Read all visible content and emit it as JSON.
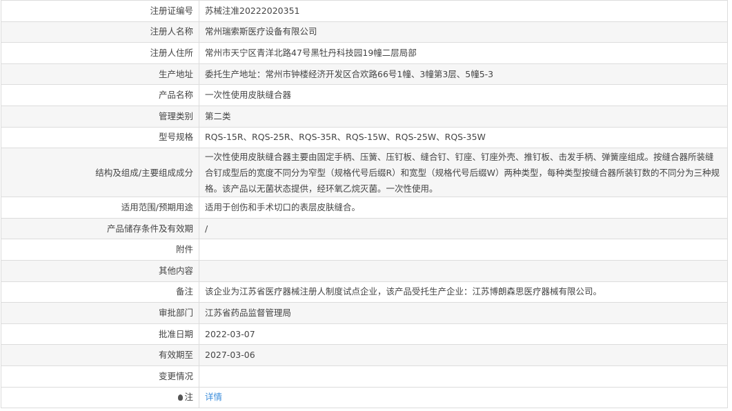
{
  "rows": [
    {
      "label": "注册证编号",
      "value": "苏械注准20222020351"
    },
    {
      "label": "注册人名称",
      "value": "常州瑞索斯医疗设备有限公司"
    },
    {
      "label": "注册人住所",
      "value": "常州市天宁区青洋北路47号黑牡丹科技园19幢二层局部"
    },
    {
      "label": "生产地址",
      "value": "委托生产地址：常州市钟楼经济开发区合欢路66号1幢、3幢第3层、5幢5-3"
    },
    {
      "label": "产品名称",
      "value": "一次性使用皮肤缝合器"
    },
    {
      "label": "管理类别",
      "value": "第二类"
    },
    {
      "label": "型号规格",
      "value": "RQS-15R、RQS-25R、RQS-35R、RQS-15W、RQS-25W、RQS-35W"
    },
    {
      "label": "结构及组成/主要组成成分",
      "value": "一次性使用皮肤缝合器主要由固定手柄、压簧、压钉板、缝合钉、钉座、钉座外壳、推钉板、击发手柄、弹簧座组成。按缝合器所装缝合钉成型后的宽度不同分为窄型（规格代号后缀R）和宽型（规格代号后缀W）两种类型，每种类型按缝合器所装钉数的不同分为三种规格。该产品以无菌状态提供，经环氧乙烷灭菌。一次性使用。"
    },
    {
      "label": "适用范围/预期用途",
      "value": "适用于创伤和手术切口的表层皮肤缝合。"
    },
    {
      "label": "产品储存条件及有效期",
      "value": "/"
    },
    {
      "label": "附件",
      "value": ""
    },
    {
      "label": "其他内容",
      "value": ""
    },
    {
      "label": "备注",
      "value": "该企业为江苏省医疗器械注册人制度试点企业，该产品受托生产企业：江苏博朗森思医疗器械有限公司。"
    },
    {
      "label": "审批部门",
      "value": "江苏省药品监督管理局"
    },
    {
      "label": "批准日期",
      "value": "2022-03-07"
    },
    {
      "label": "有效期至",
      "value": "2027-03-06"
    },
    {
      "label": "变更情况",
      "value": ""
    }
  ],
  "note": {
    "label": "注",
    "icon": "lightbulb-icon",
    "link": "详情",
    "link_color": "#3b8ddb"
  }
}
